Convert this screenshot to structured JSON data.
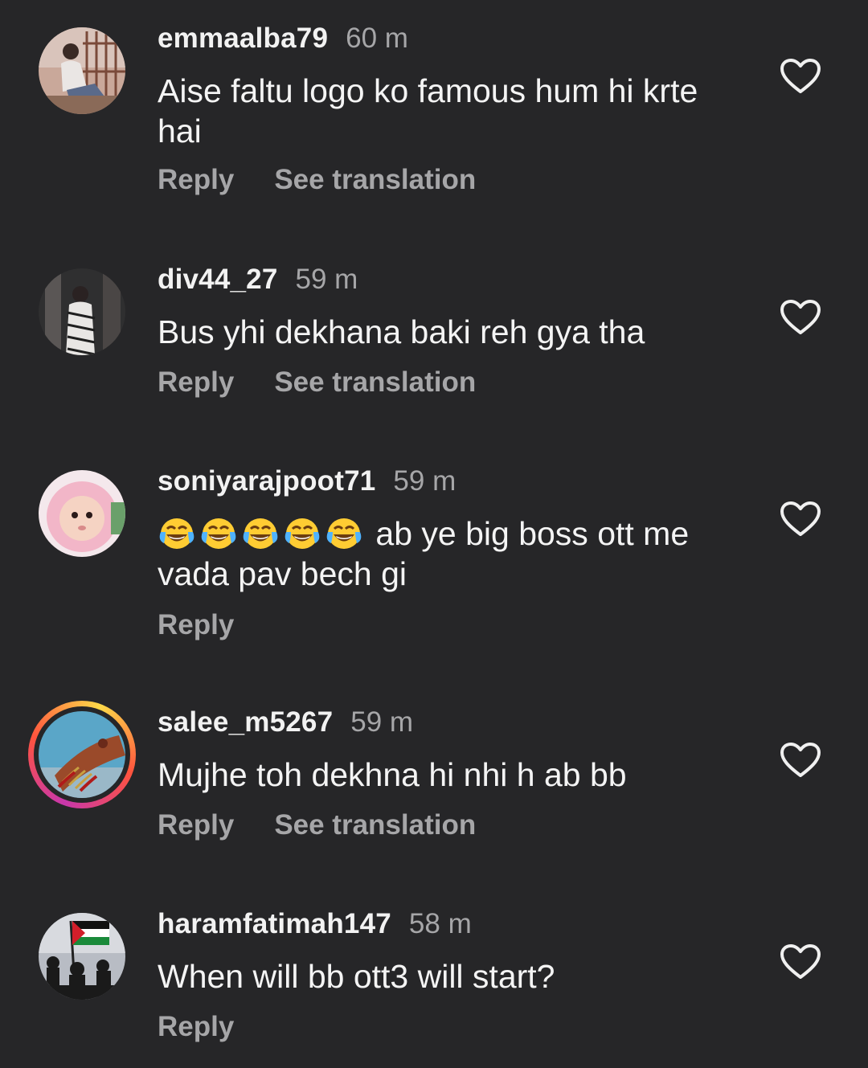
{
  "comments": [
    {
      "username": "emmaalba79",
      "time": "60 m",
      "text": "Aise faltu logo ko famous hum hi krte hai",
      "reply": "Reply",
      "see_translation": "See translation"
    },
    {
      "username": "div44_27",
      "time": "59 m",
      "text": "Bus yhi dekhana baki reh gya tha",
      "reply": "Reply",
      "see_translation": "See translation"
    },
    {
      "username": "soniyarajpoot71",
      "time": "59 m",
      "emoji": "😂😂😂😂😂",
      "emoji_name": "face-with-tears-of-joy",
      "text": " ab ye big boss ott me vada pav bech gi",
      "reply": "Reply"
    },
    {
      "username": "salee_m5267",
      "time": "59 m",
      "text": "Mujhe toh dekhna hi nhi h ab bb",
      "reply": "Reply",
      "see_translation": "See translation"
    },
    {
      "username": "haramfatimah147",
      "time": "58 m",
      "text": "When will bb ott3 will start?",
      "reply": "Reply"
    }
  ],
  "colors": {
    "background": "#262628",
    "text_primary": "#f2f2f2",
    "text_secondary": "#a6a6a8",
    "story_ring_start": "#c837ab",
    "story_ring_end": "#fdd949"
  },
  "icons": {
    "like": "heart-outline-icon",
    "laugh": "face-with-tears-of-joy-emoji"
  }
}
